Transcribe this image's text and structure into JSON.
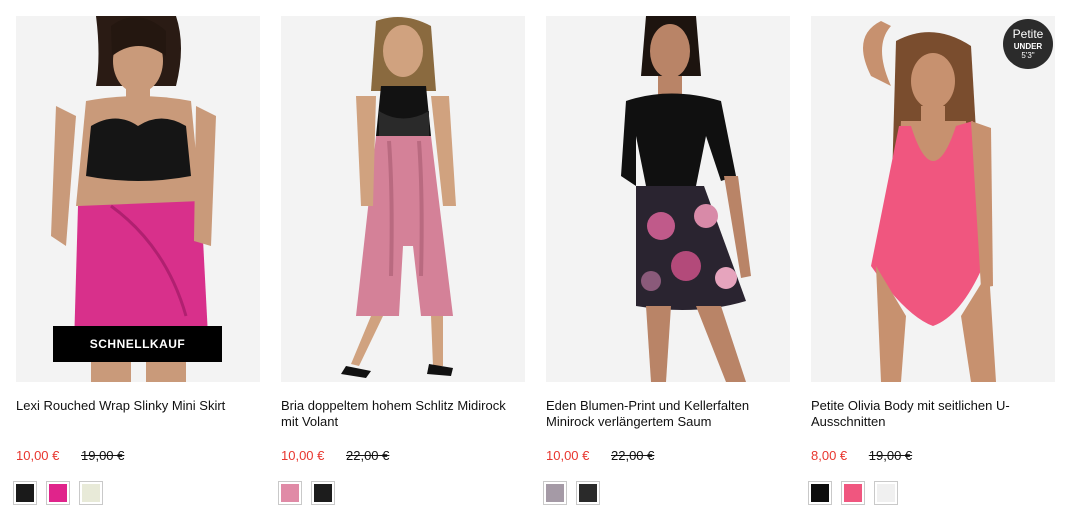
{
  "products": [
    {
      "name": "Lexi Rouched Wrap Slinky Mini Skirt",
      "price": "10,00 €",
      "old_price": "19,00 €",
      "quick_buy": "SCHNELLKAUF",
      "swatches": [
        "#1a1a1a",
        "#e0248b",
        "#e8ead8"
      ]
    },
    {
      "name": "Bria doppeltem hohem Schlitz Midirock mit Volant",
      "price": "10,00 €",
      "old_price": "22,00 €",
      "swatches": [
        "#e08aa6",
        "#1c1c1c"
      ]
    },
    {
      "name": "Eden Blumen-Print und Kellerfalten Minirock verlängertem Saum",
      "price": "10,00 €",
      "old_price": "22,00 €",
      "swatches": [
        "#a59aa6",
        "#2a2a2a"
      ]
    },
    {
      "name": "Petite Olivia Body mit seitlichen U-Ausschnitten",
      "price": "8,00 €",
      "old_price": "19,00 €",
      "badge": {
        "line1": "Petite",
        "line2": "UNDER",
        "line3": "5'3\""
      },
      "swatches": [
        "#0d0d0d",
        "#f0567f",
        "#f0f0f0"
      ]
    }
  ],
  "colors": {
    "sale_price": "#e8362e",
    "quick_buy_bg": "#000000",
    "photo_bg": "#f3f3f3"
  }
}
